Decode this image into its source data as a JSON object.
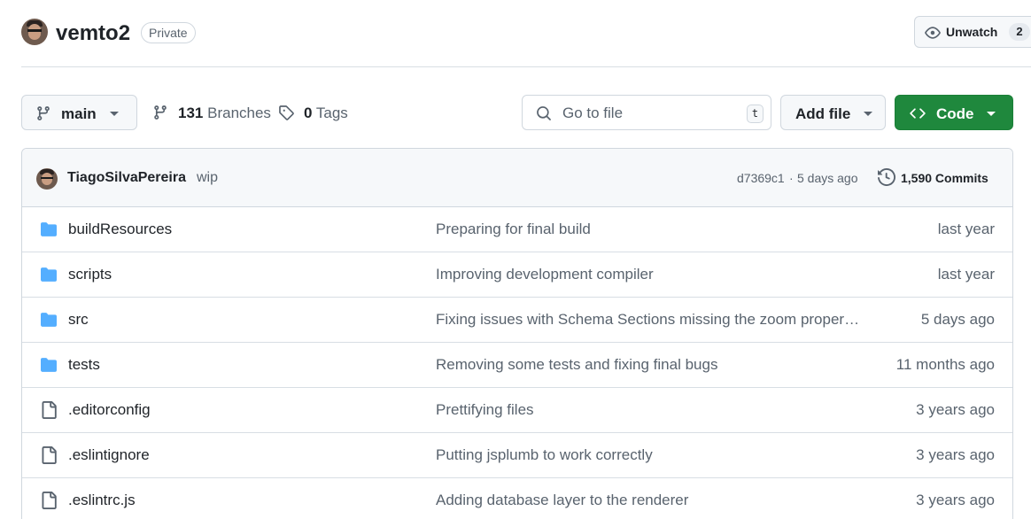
{
  "repo": {
    "name": "vemto2",
    "visibility": "Private",
    "watch_label": "Unwatch",
    "watch_count": "2"
  },
  "toolbar": {
    "branch": "main",
    "branches_count": "131",
    "branches_label": "Branches",
    "tags_count": "0",
    "tags_label": "Tags",
    "search_placeholder": "Go to file",
    "search_shortcut": "t",
    "add_file_label": "Add file",
    "code_label": "Code"
  },
  "latest_commit": {
    "author": "TiagoSilvaPereira",
    "message": "wip",
    "sha": "d7369c1",
    "separator": "·",
    "time": "5 days ago",
    "commits_label": "1,590 Commits"
  },
  "files": [
    {
      "type": "folder",
      "name": "buildResources",
      "message": "Preparing for final build",
      "time": "last year"
    },
    {
      "type": "folder",
      "name": "scripts",
      "message": "Improving development compiler",
      "time": "last year"
    },
    {
      "type": "folder",
      "name": "src",
      "message": "Fixing issues with Schema Sections missing the zoom proper…",
      "time": "5 days ago"
    },
    {
      "type": "folder",
      "name": "tests",
      "message": "Removing some tests and fixing final bugs",
      "time": "11 months ago"
    },
    {
      "type": "file",
      "name": ".editorconfig",
      "message": "Prettifying files",
      "time": "3 years ago"
    },
    {
      "type": "file",
      "name": ".eslintignore",
      "message": "Putting jsplumb to work correctly",
      "time": "3 years ago"
    },
    {
      "type": "file",
      "name": ".eslintrc.js",
      "message": "Adding database layer to the renderer",
      "time": "3 years ago"
    }
  ],
  "icons": {
    "folder": "folder-icon",
    "file": "file-icon",
    "branch": "git-branch-icon",
    "tag": "tag-icon",
    "search": "search-icon",
    "eye": "eye-icon",
    "code": "code-icon",
    "history": "history-icon"
  },
  "colors": {
    "accent_green": "#1f883d",
    "folder_blue": "#54aeff",
    "muted_text": "#59636e",
    "border": "#d0d7de"
  }
}
